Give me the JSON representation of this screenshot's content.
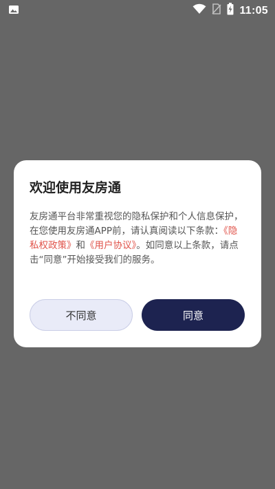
{
  "status_bar": {
    "time": "11:05",
    "icons": [
      "image-notification-icon",
      "wifi-icon",
      "no-sim-icon",
      "battery-charging-icon"
    ]
  },
  "dialog": {
    "title": "欢迎使用友房通",
    "body_part1": "友房通平台非常重视您的隐私保护和个人信息保护，在您使用友房通APP前，请认真阅读以下条款：",
    "privacy_link": "《隐私权政策》",
    "connector": "和",
    "agreement_link": "《用户协议》",
    "body_part2": "。如同意以上条款，请点击“同意”开始接受我们的服务。",
    "disagree_label": "不同意",
    "agree_label": "同意"
  },
  "colors": {
    "overlay": "#666666",
    "link": "#e0534a",
    "agree_button": "#1d2350",
    "disagree_button": "#e9ebf8"
  }
}
